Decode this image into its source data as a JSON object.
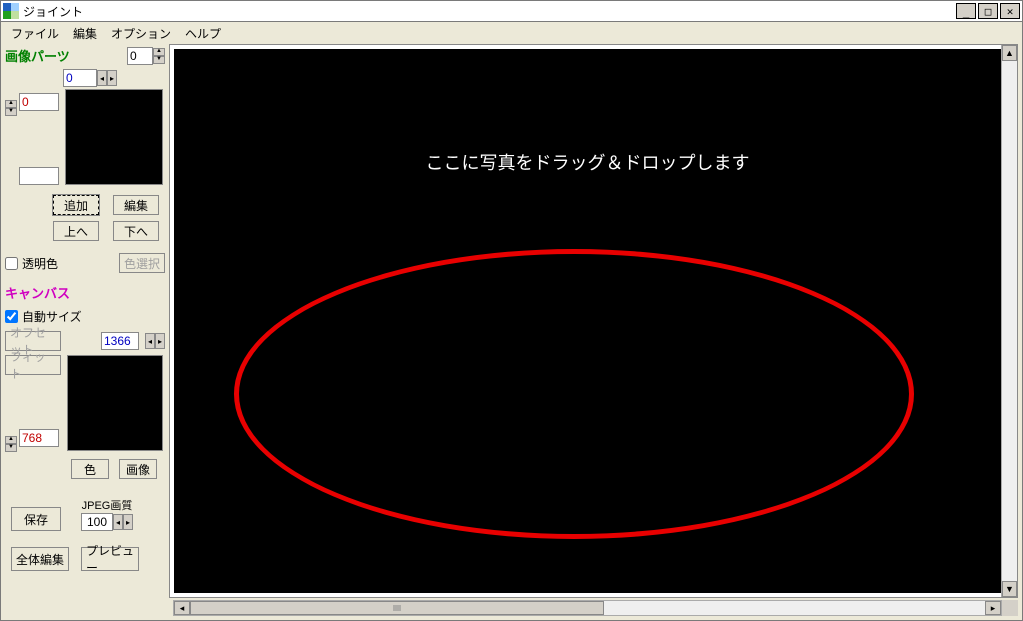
{
  "window": {
    "title": "ジョイント"
  },
  "menu": {
    "file": "ファイル",
    "edit": "編集",
    "option": "オプション",
    "help": "ヘルプ"
  },
  "side": {
    "image_parts_header": "画像パーツ",
    "top_index": "0",
    "x_value": "0",
    "y_value": "0",
    "add_btn": "追加",
    "edit_btn": "編集",
    "up_btn": "上へ",
    "down_btn": "下へ",
    "transparent_label": "透明色",
    "color_select_btn": "色選択",
    "canvas_header": "キャンバス",
    "auto_size_label": "自動サイズ",
    "offset_btn": "オフセット",
    "width_value": "1366",
    "fit_btn": "フィット",
    "height_value": "768",
    "color_btn": "色",
    "image_btn": "画像",
    "save_btn": "保存",
    "jpeg_label": "JPEG画質",
    "jpeg_value": "100",
    "full_edit_btn": "全体編集",
    "preview_btn": "プレビュー"
  },
  "canvas": {
    "drop_msg": "ここに写真をドラッグ＆ドロップします"
  }
}
